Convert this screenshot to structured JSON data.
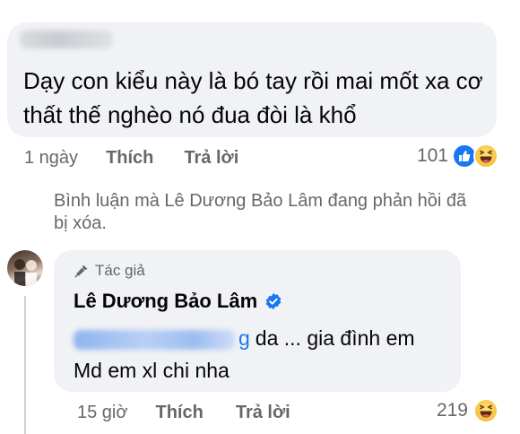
{
  "comment1": {
    "text": "Dạy con kiểu này là bó tay rồi mai mốt xa cơ thất thế nghèo nó đua đòi là khổ",
    "time": "1 ngày",
    "like_label": "Thích",
    "reply_label": "Trả lời",
    "reaction_count": "101",
    "reactions": [
      "like-icon",
      "haha-icon"
    ]
  },
  "deleted_note": "Bình luận mà Lê Dương Bảo Lâm đang phản hồi đã bị xóa.",
  "comment2": {
    "badge_label": "Tác giả",
    "author": "Lê Dương Bảo Lâm",
    "tag_suffix": "g",
    "text_after_tag": "da ... gia đình em",
    "text_line2": "Md em xl chi nha",
    "time": "15 giờ",
    "like_label": "Thích",
    "reply_label": "Trả lời",
    "reaction_count": "219",
    "reactions": [
      "haha-icon"
    ]
  },
  "colors": {
    "bubble": "#f0f2f5",
    "meta_text": "#65676b",
    "link": "#1877f2",
    "verified": "#1877f2"
  }
}
